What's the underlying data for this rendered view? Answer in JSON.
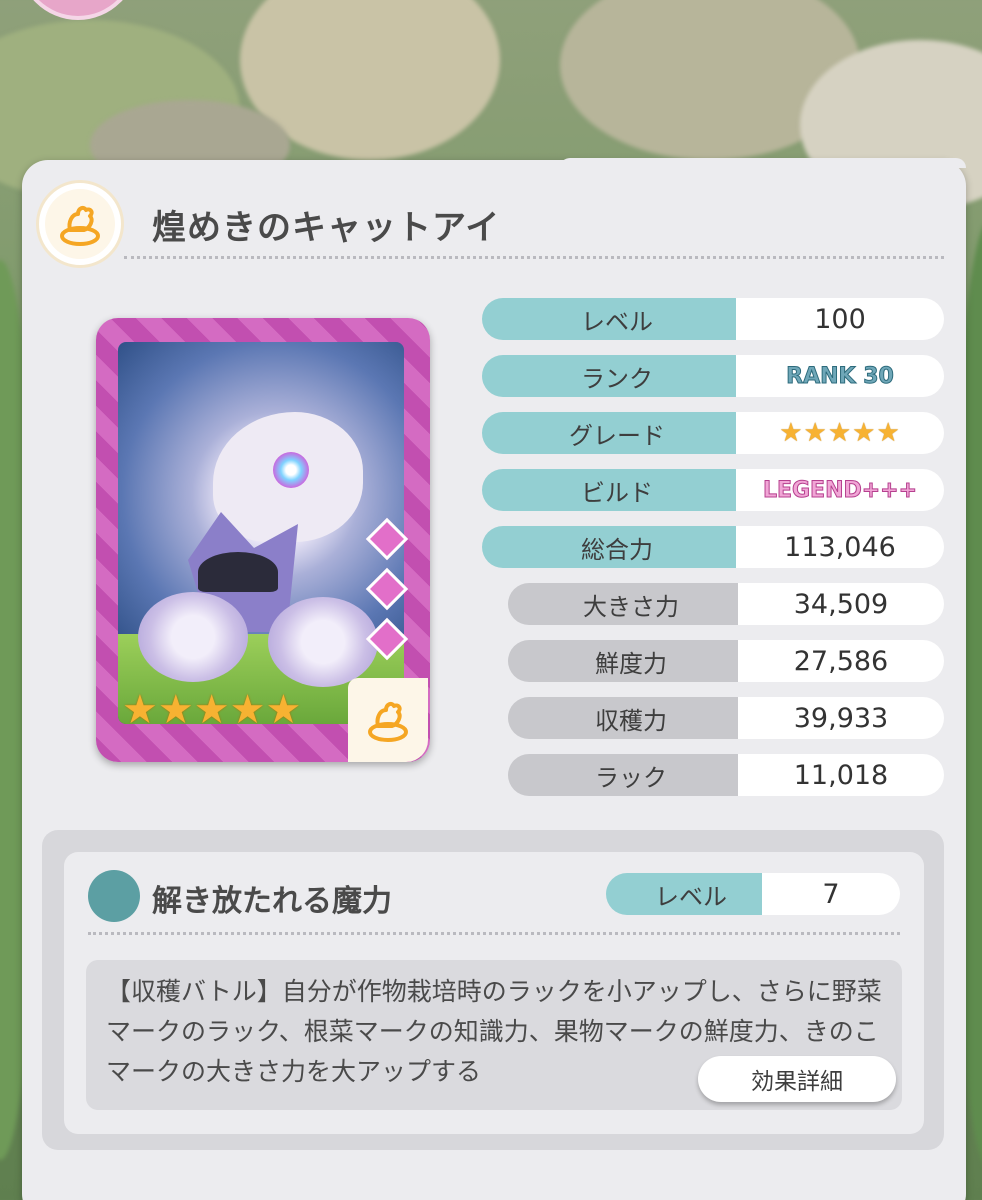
{
  "item": {
    "title": "煌めきのキャットアイ",
    "card_stars": "★★★★★"
  },
  "stats": {
    "level": {
      "label": "レベル",
      "value": "100"
    },
    "rank": {
      "label": "ランク",
      "value": "RANK 30"
    },
    "grade": {
      "label": "グレード",
      "value": "★★★★★"
    },
    "build": {
      "label": "ビルド",
      "value": "LEGEND+++"
    },
    "total": {
      "label": "総合力",
      "value": "113,046"
    },
    "size": {
      "label": "大きさ力",
      "value": "34,509"
    },
    "freshness": {
      "label": "鮮度力",
      "value": "27,586"
    },
    "harvest": {
      "label": "収穫力",
      "value": "39,933"
    },
    "luck": {
      "label": "ラック",
      "value": "11,018"
    }
  },
  "skill": {
    "name": "解き放たれる魔力",
    "level_label": "レベル",
    "level_value": "7",
    "description": "【収穫バトル】自分が作物栽培時のラックを小アップし、さらに野菜マークのラック、根菜マークの知識力、果物マークの鮮度力、きのこマークの大きさ力を大アップする",
    "detail_button": "効果詳細"
  },
  "colors": {
    "teal_label": "#93cfd2",
    "gray_label": "#c8c8cc",
    "star": "#f7b232",
    "card_frame": "#c24fb0"
  },
  "icons": {
    "badge": "cat-hand-icon"
  }
}
